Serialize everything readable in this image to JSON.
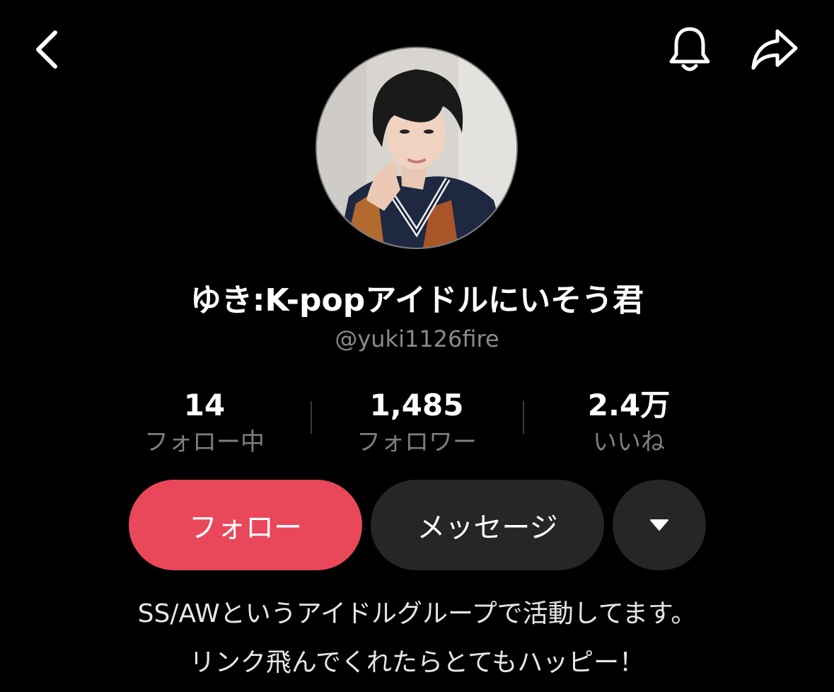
{
  "header": {
    "back_icon": "chevron-left-icon",
    "notification_icon": "bell-icon",
    "share_icon": "share-arrow-icon"
  },
  "profile": {
    "display_name": "ゆき:K-popアイドルにいそう君",
    "handle": "@yuki1126fire"
  },
  "stats": {
    "following": {
      "value": "14",
      "label": "フォロー中"
    },
    "followers": {
      "value": "1,485",
      "label": "フォロワー"
    },
    "likes": {
      "value": "2.4万",
      "label": "いいね"
    }
  },
  "actions": {
    "follow_label": "フォロー",
    "message_label": "メッセージ",
    "more_icon": "caret-down-icon"
  },
  "bio": {
    "line1": "SS/AWというアイドルグループで活動してます。",
    "line2": "リンク飛んでくれたらとてもハッピー！"
  },
  "colors": {
    "background": "#000000",
    "follow_button": "#e9485b",
    "secondary_button": "#262626",
    "muted_text": "#8a8a8a"
  }
}
